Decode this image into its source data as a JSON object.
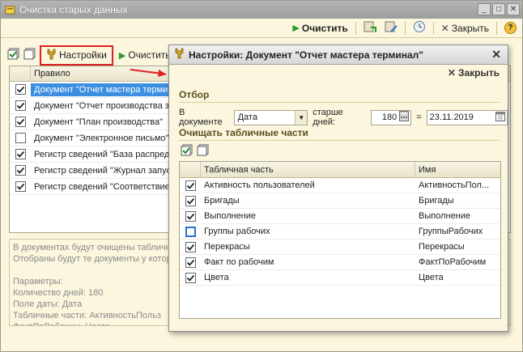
{
  "window": {
    "title": "Очистка старых данных"
  },
  "main_toolbar": {
    "clear_label": "Очистить",
    "close_label": "Закрыть",
    "help_label": "?"
  },
  "inner_toolbar": {
    "settings_label": "Настройки",
    "clear_label": "Очистить"
  },
  "rules_grid": {
    "column_header": "Правило",
    "rows": [
      {
        "checked": true,
        "text": "Документ \"Отчет мастера терминал\"",
        "selected": true
      },
      {
        "checked": true,
        "text": "Документ \"Отчет производства з",
        "selected": false
      },
      {
        "checked": true,
        "text": "Документ \"План производства\"",
        "selected": false
      },
      {
        "checked": false,
        "text": "Документ \"Электронное письмо\"",
        "selected": false
      },
      {
        "checked": true,
        "text": "Регистр сведений \"База распред",
        "selected": false
      },
      {
        "checked": true,
        "text": "Регистр сведений \"Журнал запус",
        "selected": false
      },
      {
        "checked": true,
        "text": "Регистр сведений \"Соответствие",
        "selected": false
      }
    ]
  },
  "info": {
    "lines": [
      "В документах будут очищены табличн",
      "Отобраны будут те документы у котор",
      "",
      "Параметры:",
      "    Количество дней: 180",
      "    Поле даты: Дата",
      "    Табличные части: АктивностьПольз",
      "ФактПоРабочим, Цвета"
    ]
  },
  "dialog": {
    "title": "Настройки: Документ \"Отчет мастера терминал\"",
    "close_label": "Закрыть",
    "filter_section": "Отбор",
    "in_document_label": "В документе",
    "date_field_value": "Дата",
    "older_days_label": "старше дней:",
    "days_value": "180",
    "equals_label": "=",
    "date_value": "23.11.2019",
    "clear_parts_section": "Очищать табличные части",
    "table": {
      "col_part": "Табличная часть",
      "col_name": "Имя",
      "rows": [
        {
          "checked": true,
          "part": "Активность пользователей",
          "name": "АктивностьПол..."
        },
        {
          "checked": true,
          "part": "Бригады",
          "name": "Бригады"
        },
        {
          "checked": true,
          "part": "Выполнение",
          "name": "Выполнение"
        },
        {
          "checked": false,
          "part": "Группы рабочих",
          "name": "ГруппыРабочих",
          "focus": true
        },
        {
          "checked": true,
          "part": "Перекрасы",
          "name": "Перекрасы"
        },
        {
          "checked": true,
          "part": "Факт по рабочим",
          "name": "ФактПоРабочим"
        },
        {
          "checked": true,
          "part": "Цвета",
          "name": "Цвета"
        }
      ]
    }
  },
  "colors": {
    "background": "#fbf6dd",
    "selection": "#3c8fe0",
    "highlight_border": "#e02020",
    "arrow": "#e02020"
  }
}
